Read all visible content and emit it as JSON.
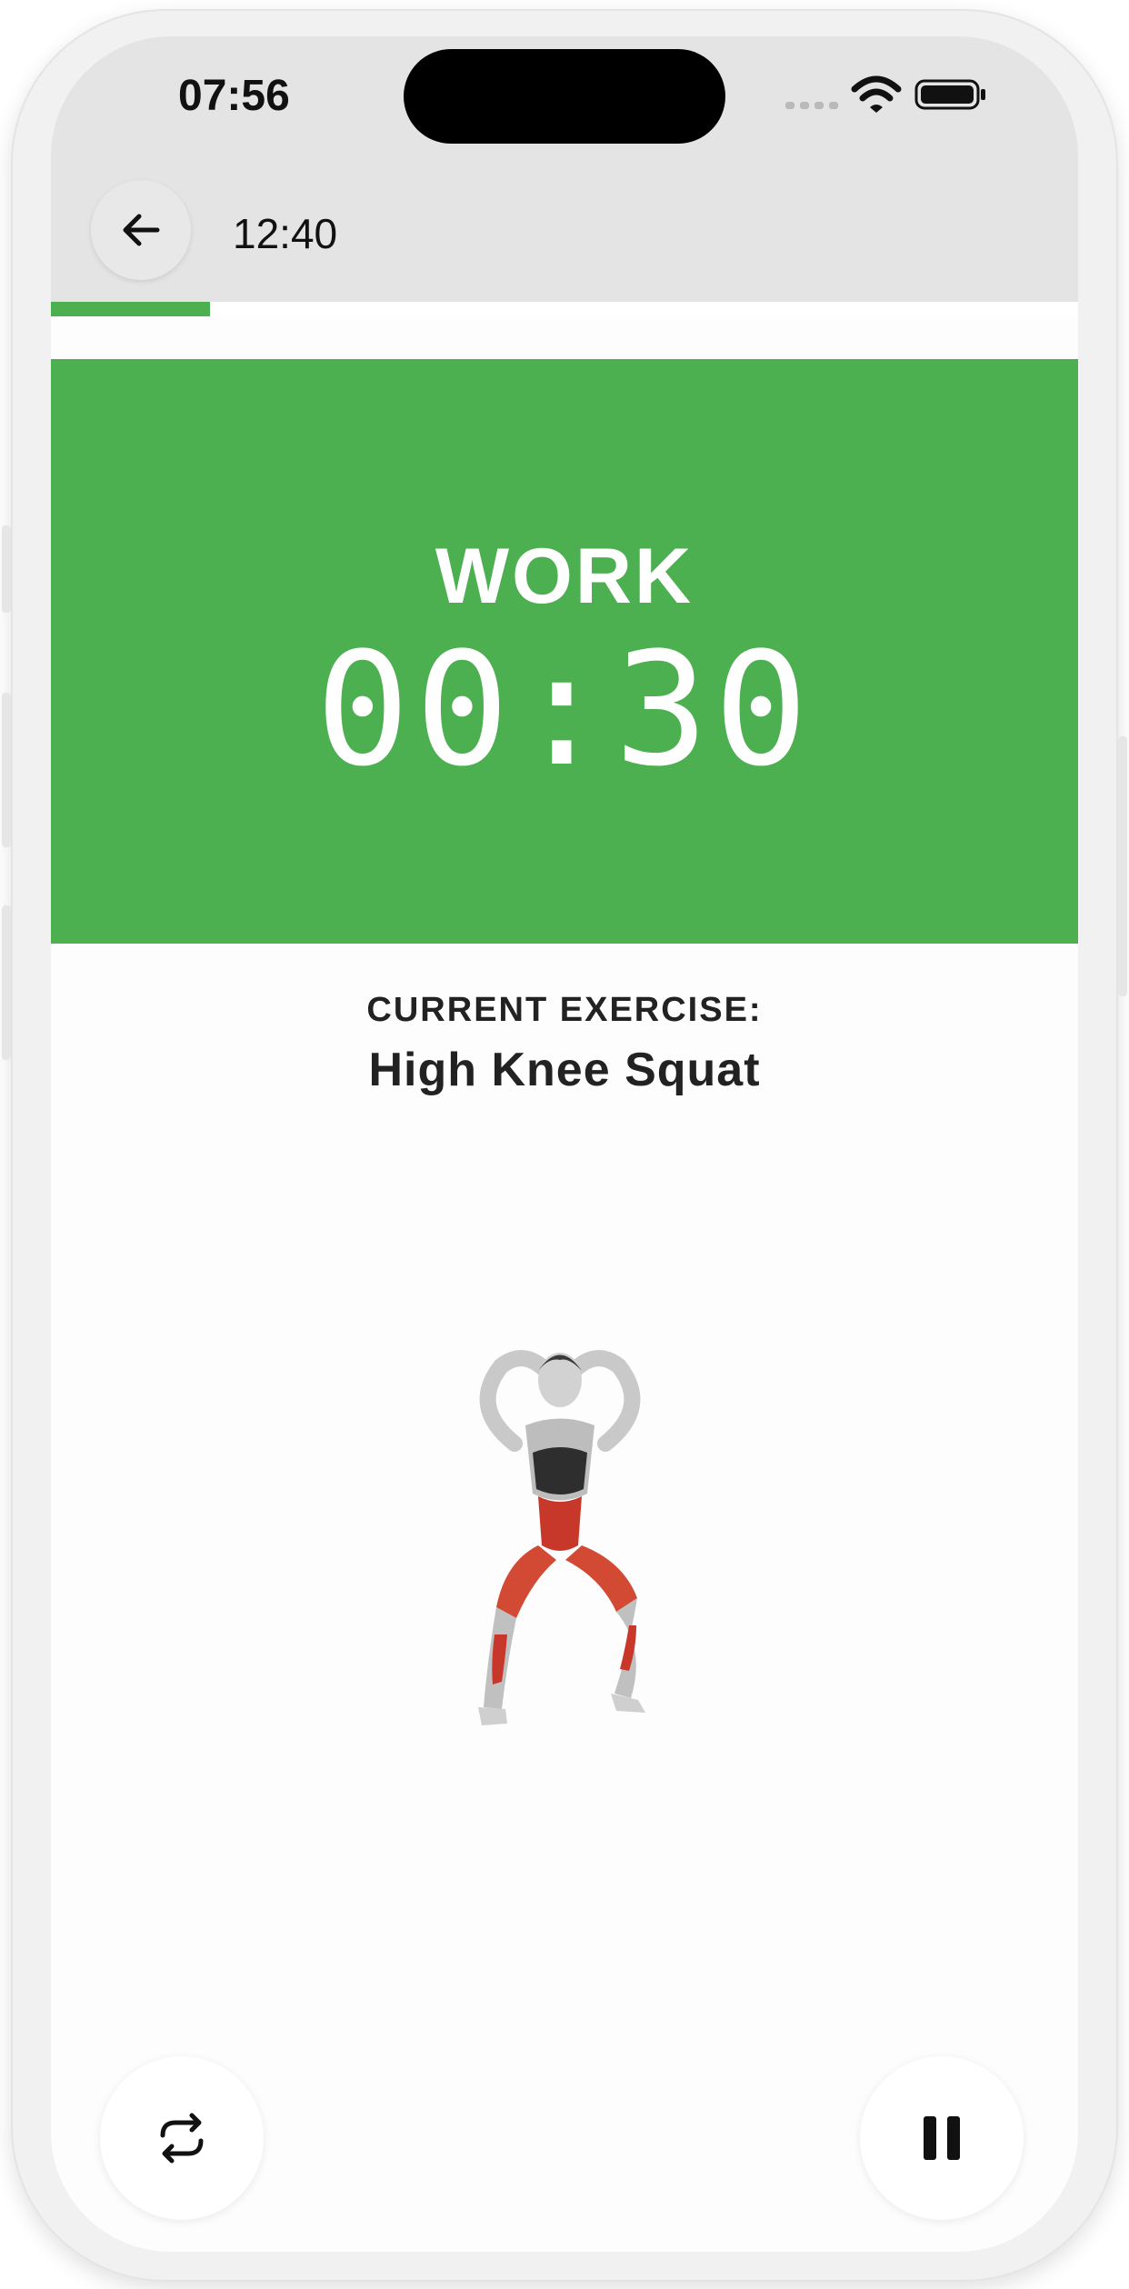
{
  "status_bar": {
    "time": "07:56",
    "icons": [
      "cellular-signal-icon",
      "wifi-icon",
      "battery-icon"
    ]
  },
  "header": {
    "back_icon": "arrow-left-icon",
    "total_time": "12:40"
  },
  "progress": {
    "fraction": 0.155,
    "color": "#4caf50"
  },
  "phase": {
    "label": "WORK",
    "timer": "00:30",
    "color": "#4caf50"
  },
  "exercise": {
    "caption": "CURRENT EXERCISE:",
    "name": "High Knee Squat",
    "illustration": "high-knee-squat-figure"
  },
  "controls": {
    "repeat_icon": "repeat-icon",
    "pause_icon": "pause-icon"
  }
}
